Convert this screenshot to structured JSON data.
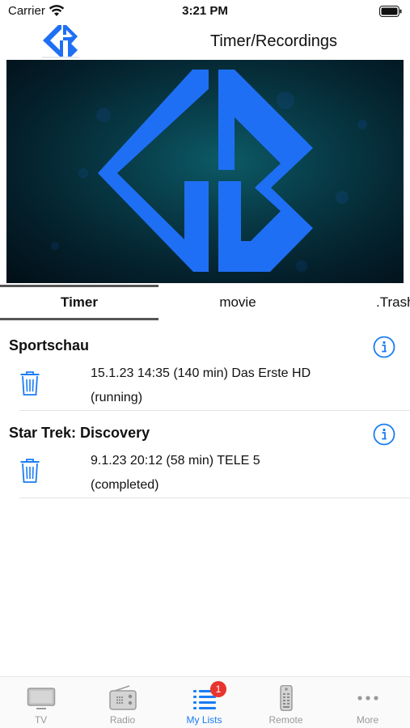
{
  "status_bar": {
    "carrier": "Carrier",
    "time": "3:21 PM"
  },
  "header": {
    "title": "Timer/Recordings",
    "logo_icon": "gb-logo-icon"
  },
  "preview": {
    "logo_icon": "gb-logo-icon"
  },
  "tabs": [
    {
      "label": "Timer",
      "active": true
    },
    {
      "label": "movie",
      "active": false
    },
    {
      "label": ".Trash",
      "active": false
    }
  ],
  "entries": [
    {
      "title": "Sportschau",
      "line1": "15.1.23 14:35 (140 min) Das Erste HD",
      "line2": "(running)"
    },
    {
      "title": "Star Trek: Discovery",
      "line1": "9.1.23 20:12 (58 min) TELE 5",
      "line2": "(completed)"
    }
  ],
  "tabbar": {
    "items": [
      {
        "label": "TV",
        "icon": "tv-icon",
        "active": false
      },
      {
        "label": "Radio",
        "icon": "radio-icon",
        "active": false
      },
      {
        "label": "My Lists",
        "icon": "list-icon",
        "active": true,
        "badge": "1"
      },
      {
        "label": "Remote",
        "icon": "remote-icon",
        "active": false
      },
      {
        "label": "More",
        "icon": "more-icon",
        "active": false
      }
    ]
  },
  "colors": {
    "accent": "#1a7cf5",
    "logo_blue": "#1f6ff5",
    "badge_red": "#e8342f",
    "inactive_gray": "#9a9a9a"
  }
}
